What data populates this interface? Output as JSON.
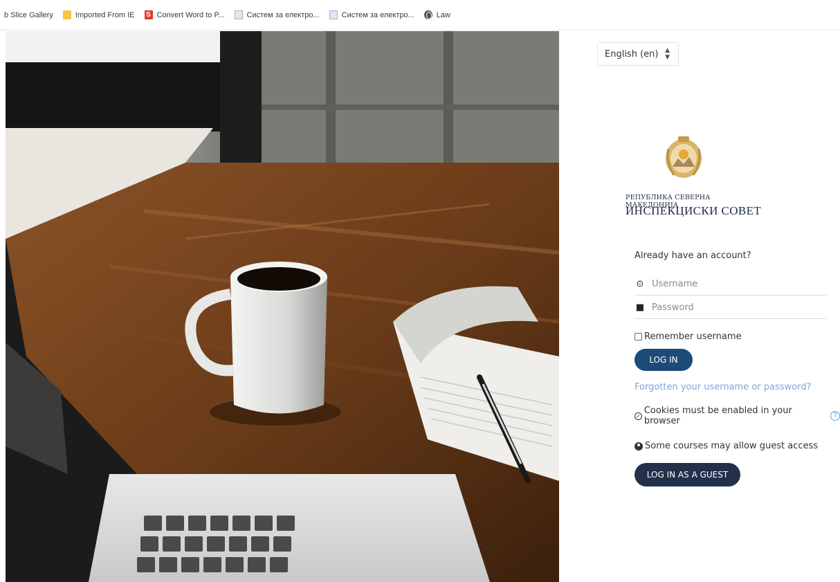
{
  "bookmarks": [
    {
      "label": "b Slice Gallery",
      "icon": "none"
    },
    {
      "label": "Imported From IE",
      "icon": "folder-icon"
    },
    {
      "label": "Convert Word to P...",
      "icon": "s-app-icon"
    },
    {
      "label": "Систем за електро...",
      "icon": "document-icon"
    },
    {
      "label": "Систем за електро...",
      "icon": "document-icon"
    },
    {
      "label": "Law",
      "icon": "globe-icon"
    }
  ],
  "language": {
    "selected": "English (en)"
  },
  "organization": {
    "line1": "РЕПУБЛИКА СЕВЕРНА МАКЕДОНИЈА",
    "line2": "ИНСПЕКЦИСКИ СОВЕТ"
  },
  "login": {
    "heading": "Already have an account?",
    "username_placeholder": "Username",
    "password_placeholder": "Password",
    "remember_label": "Remember username",
    "login_button": "LOG IN",
    "forgot_link": "Forgotten your username or password?",
    "cookies_notice": "Cookies must be enabled in your browser",
    "guest_notice": "Some courses may allow guest access",
    "guest_button": "LOG IN AS A GUEST"
  },
  "colors": {
    "primary_button": "#1e4a78",
    "guest_button": "#22304a",
    "link": "#7ea6d8",
    "help_icon": "#5aa0d8"
  }
}
